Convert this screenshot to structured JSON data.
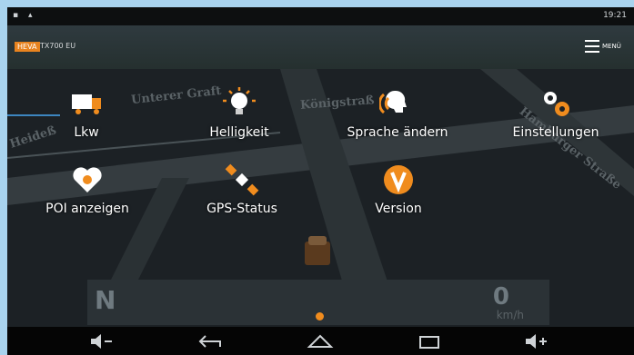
{
  "statusbar": {
    "left_icons": "▪ ▴",
    "time": "19:21"
  },
  "header": {
    "logo": "HEVA",
    "model": "TX700 EU",
    "menu_label": "MENÜ"
  },
  "map": {
    "streets": [
      "Unterer Graft",
      "Königstraß",
      "Hamburger Straße",
      "Heideß"
    ]
  },
  "tiles": [
    {
      "label": "Lkw",
      "icon": "truck-icon"
    },
    {
      "label": "Helligkeit",
      "icon": "bulb-icon"
    },
    {
      "label": "Sprache ändern",
      "icon": "speech-icon"
    },
    {
      "label": "Einstellungen",
      "icon": "gears-icon"
    },
    {
      "label": "POI anzeigen",
      "icon": "poi-heart-icon"
    },
    {
      "label": "GPS-Status",
      "icon": "satellite-icon"
    },
    {
      "label": "Version",
      "icon": "version-v-icon"
    }
  ],
  "speed": {
    "direction": "N",
    "value": "0",
    "unit": "km/h"
  },
  "colors": {
    "accent": "#f08c1e",
    "background": "#1c2125",
    "pointer": "#3d86c0"
  },
  "navbar": [
    "volume-down-icon",
    "back-icon",
    "home-icon",
    "recents-icon",
    "volume-up-icon"
  ]
}
